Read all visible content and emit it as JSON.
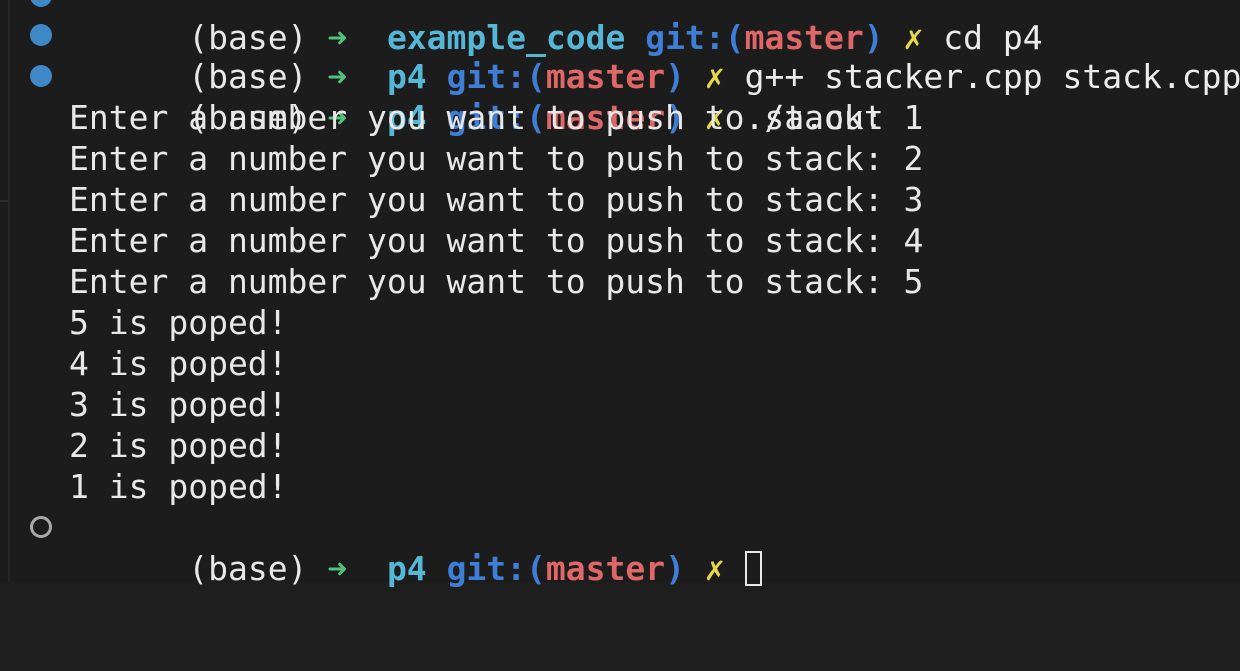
{
  "prompt": {
    "env": "(base)",
    "arrow": "➜",
    "dir": "p4",
    "git_label": "git:(",
    "branch": "master",
    "git_close": ")",
    "dirty_mark": "✗"
  },
  "top_cut": {
    "env": "(base)",
    "arrow": "➜",
    "dir": "example_code",
    "git_label": "git:(",
    "branch": "master",
    "git_close": ")",
    "dirty_mark": "✗",
    "command": "cd p4"
  },
  "commands": [
    "g++ stacker.cpp stack.cpp",
    "./a.out"
  ],
  "output": [
    "Enter a number you want to push to stack: 1",
    "Enter a number you want to push to stack: 2",
    "Enter a number you want to push to stack: 3",
    "Enter a number you want to push to stack: 4",
    "Enter a number you want to push to stack: 5",
    "5 is poped!",
    "4 is poped!",
    "3 is poped!",
    "2 is poped!",
    "1 is poped!"
  ],
  "colors": {
    "background": "#1c1c1c",
    "arrow": "#4fc27e",
    "dir": "#56b6d6",
    "git": "#3f7ed6",
    "branch": "#e06767",
    "dirty": "#e6d84d",
    "gutter_done": "#3f88c6",
    "gutter_pending": "#a9a9a9"
  }
}
